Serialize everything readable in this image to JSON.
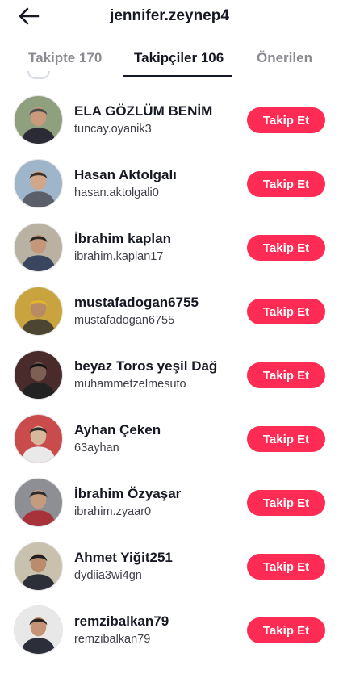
{
  "header": {
    "title": "jennifer.zeynep4",
    "back_icon": "arrow-left-icon"
  },
  "tabs": [
    {
      "label": "Takipte 170",
      "active": false
    },
    {
      "label": "Takipçiler 106",
      "active": true
    },
    {
      "label": "Önerilen",
      "active": false
    }
  ],
  "colors": {
    "accent": "#fe2c55",
    "text_primary": "#161823",
    "text_secondary": "#8a8b91"
  },
  "users": [
    {
      "name": "ELA GÖZLÜM BENİM",
      "handle": "tuncay.oyanik3",
      "button": "Takip Et",
      "avatar": {
        "bg": "#8fa07e",
        "skin": "#c99a7b",
        "hair": "#4a4a4a",
        "shirt": "#2b2b35"
      }
    },
    {
      "name": "Hasan Aktolgalı",
      "handle": "hasan.aktolgali0",
      "button": "Takip Et",
      "avatar": {
        "bg": "#9fb5c9",
        "skin": "#d2a789",
        "hair": "#3d2f28",
        "shirt": "#5a5f6a"
      }
    },
    {
      "name": "İbrahim kaplan",
      "handle": "ibrahim.kaplan17",
      "button": "Takip Et",
      "avatar": {
        "bg": "#b9b2a3",
        "skin": "#c4967a",
        "hair": "#2a2623",
        "shirt": "#3a4560"
      }
    },
    {
      "name": "mustafadogan6755",
      "handle": "mustafadogan6755",
      "button": "Takip Et",
      "avatar": {
        "bg": "#c9a43e",
        "skin": "#b98a66",
        "hair": "#e1b52b",
        "shirt": "#4d4533"
      }
    },
    {
      "name": "beyaz Toros yeşil Dağ",
      "handle": "muhammetzelmesuto",
      "button": "Takip Et",
      "avatar": {
        "bg": "#4a2b2b",
        "skin": "#7d5f55",
        "hair": "#111111",
        "shirt": "#222222"
      }
    },
    {
      "name": "Ayhan Çeken",
      "handle": "63ayhan",
      "button": "Takip Et",
      "avatar": {
        "bg": "#c94b4b",
        "skin": "#d8b89c",
        "hair": "#2b2b2b",
        "shirt": "#e9e9e9"
      }
    },
    {
      "name": "İbrahim Özyaşar",
      "handle": "ibrahim.zyaar0",
      "button": "Takip Et",
      "avatar": {
        "bg": "#8d8f95",
        "skin": "#c59b7e",
        "hair": "#2a2a2a",
        "shirt": "#a7323a"
      }
    },
    {
      "name": "Ahmet Yiğit251",
      "handle": "dydiia3wi4gn",
      "button": "Takip Et",
      "avatar": {
        "bg": "#c7c1ae",
        "skin": "#b98c6e",
        "hair": "#1e1e1e",
        "shirt": "#2d2f38"
      }
    },
    {
      "name": "remzibalkan79",
      "handle": "remzibalkan79",
      "button": "Takip Et",
      "avatar": {
        "bg": "#e8e8e8",
        "skin": "#c59477",
        "hair": "#2a2420",
        "shirt": "#2c2f3a"
      }
    }
  ]
}
